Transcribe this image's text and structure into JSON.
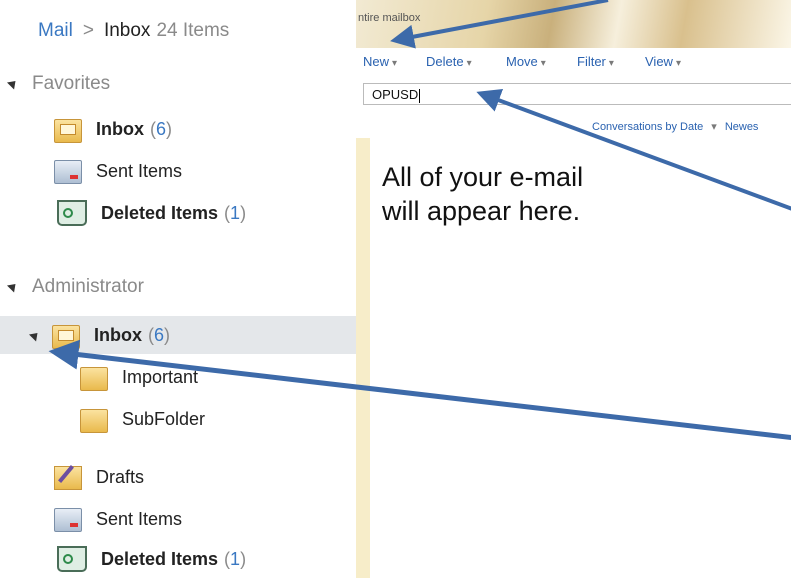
{
  "breadcrumb": {
    "root": "Mail",
    "separator": ">",
    "current": "Inbox",
    "count": "24 Items"
  },
  "favorites": {
    "title": "Favorites",
    "items": [
      {
        "label": "Inbox",
        "count": "6",
        "icon": "inbox-folder-icon"
      },
      {
        "label": "Sent Items",
        "icon": "sent-items-icon"
      },
      {
        "label": "Deleted Items",
        "count": "1",
        "icon": "trash-icon"
      }
    ]
  },
  "mailbox": {
    "title": "Administrator",
    "inbox": {
      "label": "Inbox",
      "count": "6"
    },
    "subfolders": [
      {
        "label": "Important"
      },
      {
        "label": "SubFolder"
      }
    ],
    "items": [
      {
        "label": "Drafts",
        "icon": "drafts-icon"
      },
      {
        "label": "Sent Items",
        "icon": "sent-items-icon"
      },
      {
        "label": "Deleted Items",
        "count": "1",
        "icon": "trash-icon"
      }
    ]
  },
  "banner": {
    "text": "ntire mailbox"
  },
  "toolbar": {
    "new": "New",
    "delete": "Delete",
    "move": "Move",
    "filter": "Filter",
    "view": "View"
  },
  "search": {
    "value": "OPUSD"
  },
  "sort": {
    "conversations": "Conversations by Date",
    "newest": "Newes"
  },
  "annotation": {
    "line1": "All of your e-mail",
    "line2": "will appear here."
  },
  "colors": {
    "accent": "#3a78c2",
    "arrow": "#3d6aa9",
    "selection": "#e4e7ea",
    "stripe": "#f7edc9"
  }
}
